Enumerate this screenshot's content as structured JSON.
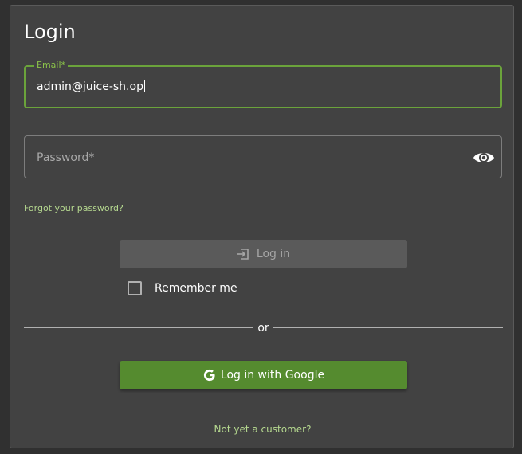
{
  "login": {
    "title": "Login",
    "email": {
      "label": "Email*",
      "value": "admin@juice-sh.op"
    },
    "password": {
      "placeholder": "Password*",
      "visibility_icon": "eye-icon"
    },
    "forgot_password": "Forgot your password?",
    "login_button": {
      "label": "Log in",
      "icon": "login-icon",
      "disabled": true
    },
    "remember_me": {
      "label": "Remember me",
      "checked": false
    },
    "divider_text": "or",
    "google_button": {
      "label": "Log in with Google",
      "icon": "google-icon"
    },
    "register_link": "Not yet a customer?"
  },
  "colors": {
    "page_background": "#303030",
    "card_background": "#424242",
    "accent_green": "#8bc34a",
    "focus_border": "#6ba33b",
    "google_button": "#558b2f",
    "disabled_button": "#5a5a5a",
    "link": "#b5d88f"
  }
}
